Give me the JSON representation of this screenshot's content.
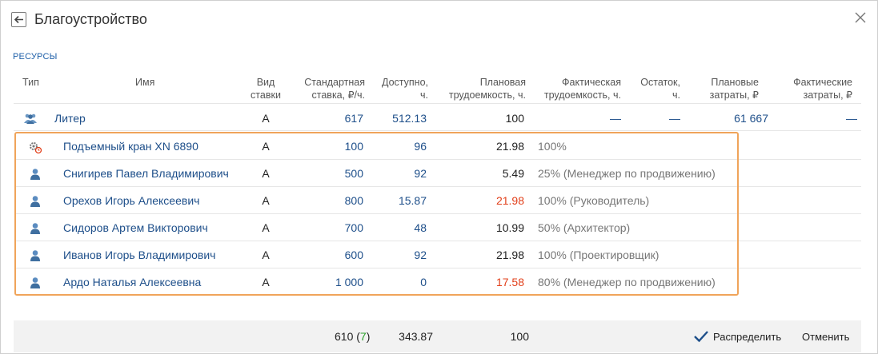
{
  "dialog": {
    "title": "Благоустройство",
    "section_label": "РЕСУРСЫ"
  },
  "columns": {
    "type": "Тип",
    "name": "Имя",
    "rate_kind": [
      "Вид",
      "ставки"
    ],
    "std_rate": [
      "Стандартная",
      "ставка, ₽/ч."
    ],
    "available": [
      "Доступно,",
      "ч."
    ],
    "plan_labor": [
      "Плановая",
      "трудоемкость, ч."
    ],
    "fact_labor": [
      "Фактическая",
      "трудоемкость, ч."
    ],
    "remainder": [
      "Остаток,",
      "ч."
    ],
    "plan_cost": [
      "Плановые",
      "затраты, ₽"
    ],
    "fact_cost": [
      "Фактические",
      "затраты, ₽"
    ]
  },
  "group_row": {
    "name": "Литер",
    "rate_kind": "А",
    "std_rate": "617",
    "available": "512.13",
    "plan_labor": "100",
    "fact_labor": "—",
    "remainder": "—",
    "plan_cost": "61 667",
    "fact_cost": "—"
  },
  "rows": [
    {
      "icon": "crane-gear-icon",
      "name": "Подъемный кран XN 6890",
      "rate_kind": "А",
      "std_rate": "100",
      "available": "96",
      "plan_labor": "21.98",
      "plan_color": "dark",
      "fact_labor": "100%"
    },
    {
      "icon": "person-icon",
      "name": "Снигирев Павел Владимирович",
      "rate_kind": "А",
      "std_rate": "500",
      "available": "92",
      "plan_labor": "5.49",
      "plan_color": "dark",
      "fact_labor": "25% (Менеджер по продвижению)"
    },
    {
      "icon": "person-icon",
      "name": "Орехов Игорь Алексеевич",
      "rate_kind": "А",
      "std_rate": "800",
      "available": "15.87",
      "plan_labor": "21.98",
      "plan_color": "red",
      "fact_labor": "100% (Руководитель)"
    },
    {
      "icon": "person-icon",
      "name": "Сидоров Артем Викторович",
      "rate_kind": "А",
      "std_rate": "700",
      "available": "48",
      "plan_labor": "10.99",
      "plan_color": "dark",
      "fact_labor": "50% (Архитектор)"
    },
    {
      "icon": "person-icon",
      "name": "Иванов Игорь Владимирович",
      "rate_kind": "А",
      "std_rate": "600",
      "available": "92",
      "plan_labor": "21.98",
      "plan_color": "dark",
      "fact_labor": "100% (Проектировщик)"
    },
    {
      "icon": "person-icon",
      "name": "Ардо Наталья Алексеевна",
      "rate_kind": "А",
      "std_rate": "1 000",
      "available": "0",
      "plan_labor": "17.58",
      "plan_color": "red",
      "fact_labor": "80% (Менеджер по продвижению)"
    }
  ],
  "footer": {
    "rate_total": "610",
    "rate_count": "7",
    "available_total": "343.87",
    "labor_total": "100",
    "distribute_label": "Распределить",
    "cancel_label": "Отменить"
  },
  "colors": {
    "accent": "#1e4f8a",
    "highlight": "#f0a45a",
    "warning": "#e2401b",
    "ok": "#2aa02a"
  }
}
